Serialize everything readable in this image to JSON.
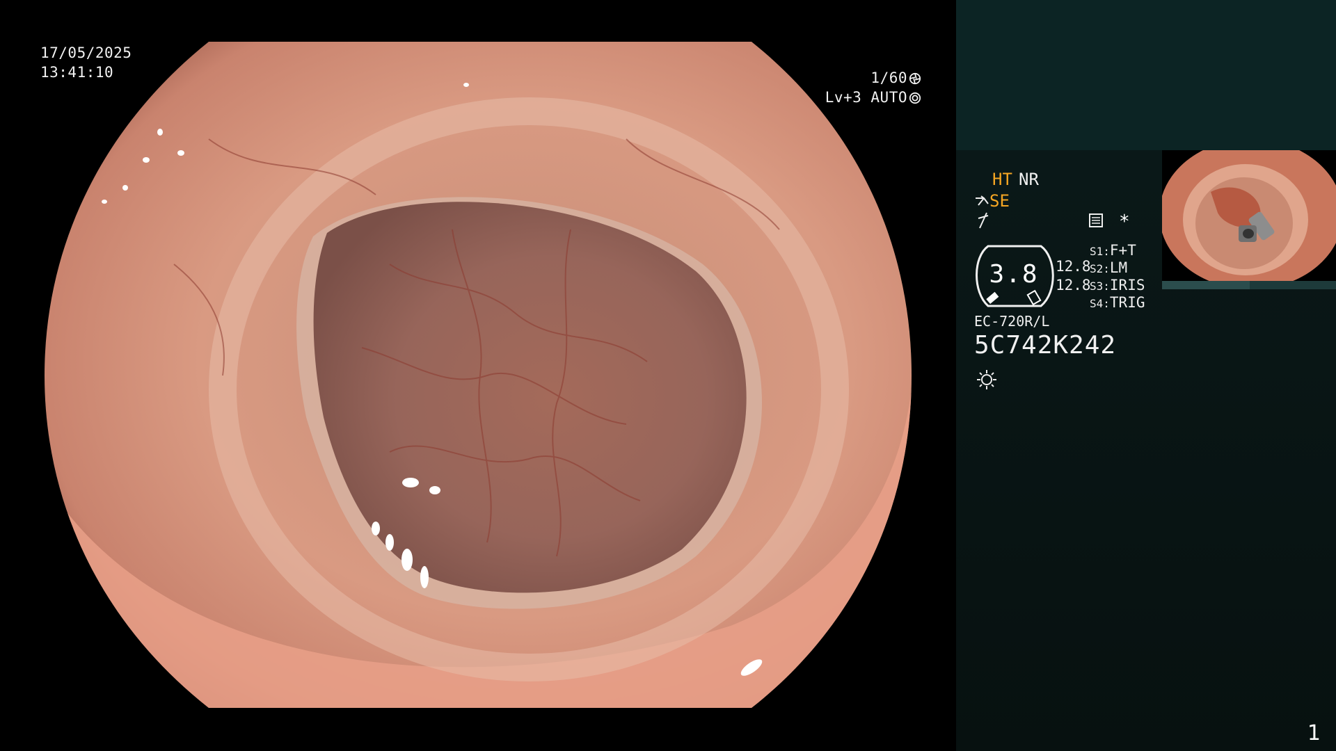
{
  "main_view": {
    "date": "17/05/2025",
    "time": "13:41:10",
    "shutter_speed": "1/60",
    "iris_level": "Lv+3 AUTO",
    "shutter_icon": "aperture-icon",
    "iris_icon": "iris-icon"
  },
  "side_panel": {
    "ht": "HT",
    "nr": "NR",
    "se": "SE",
    "gauge_value": "3.8",
    "values": [
      "12.8",
      "12.8"
    ],
    "switches": [
      {
        "key": "S1:",
        "value": "F+T"
      },
      {
        "key": "S2:",
        "value": "LM"
      },
      {
        "key": "S3:",
        "value": "IRIS"
      },
      {
        "key": "S4:",
        "value": "TRIG"
      }
    ],
    "scope_model": "EC-720R/L",
    "scope_serial": "5C742K242",
    "light_icon": "light-sun-icon",
    "page_number": "1"
  },
  "colors": {
    "panel_bg": "#071110",
    "panel_top": "#0c2424",
    "accent": "#f5a623"
  }
}
